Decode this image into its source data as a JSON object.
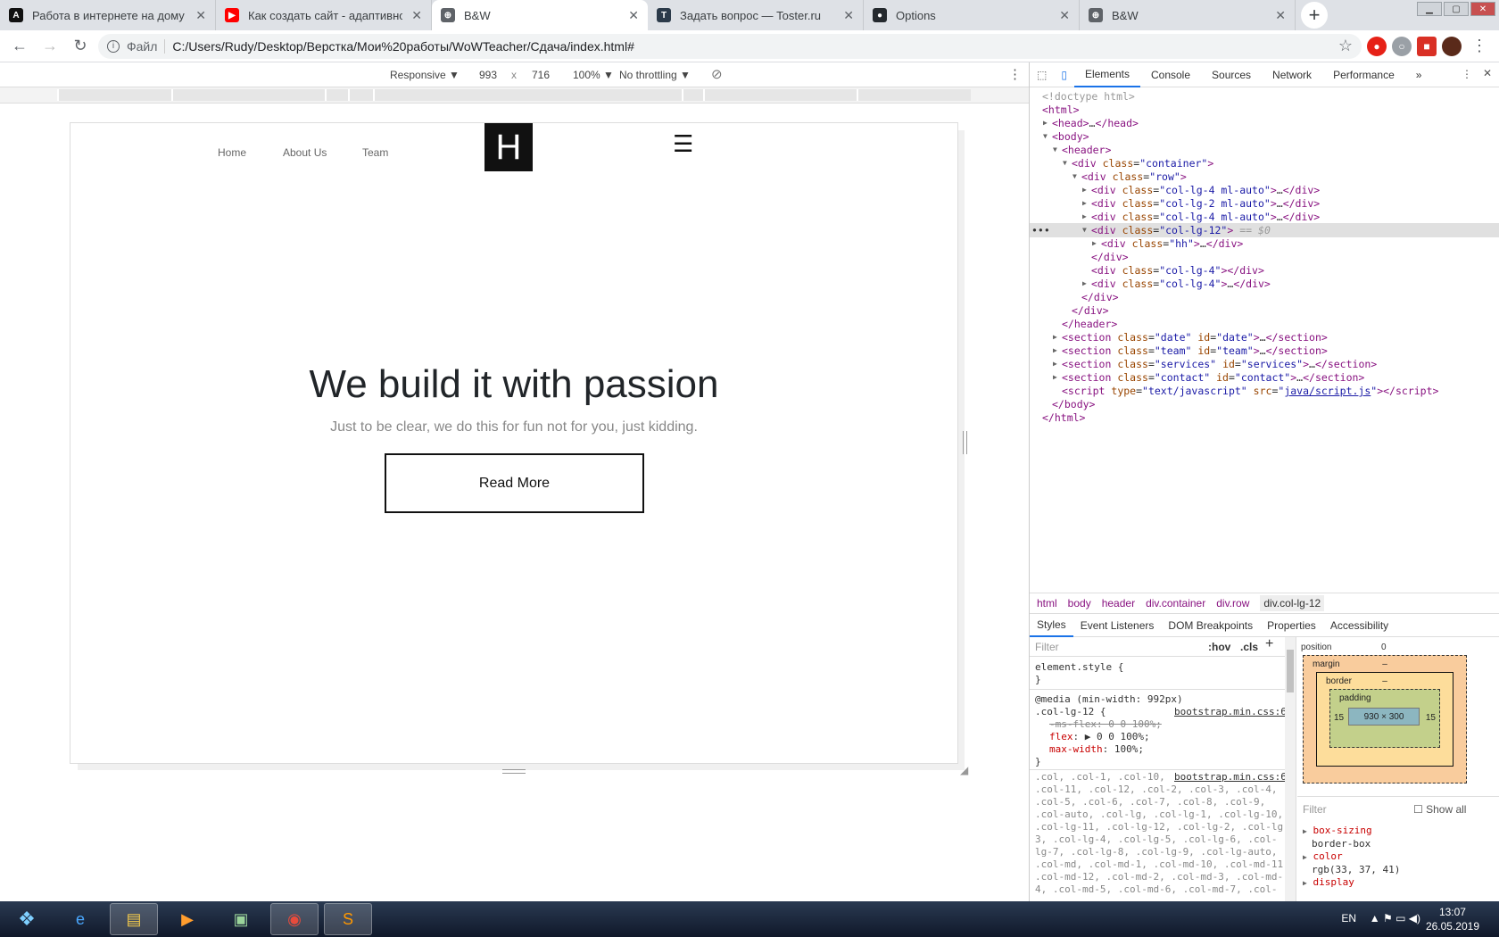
{
  "browser": {
    "tabs": [
      {
        "title": "Работа в интернете на дому он",
        "favicon": "A",
        "color": "#111111"
      },
      {
        "title": "Как создать сайт - адаптивное",
        "favicon": "▶",
        "color": "#ff0000"
      },
      {
        "title": "B&W",
        "favicon": "⊕",
        "color": "#5f6368",
        "active": true
      },
      {
        "title": "Задать вопрос — Toster.ru",
        "favicon": "T",
        "color": "#2b3a4a"
      },
      {
        "title": "Options",
        "favicon": "●",
        "color": "#24292e"
      },
      {
        "title": "B&W",
        "favicon": "⊕",
        "color": "#5f6368"
      }
    ],
    "address_label": "Файл",
    "url": "C:/Users/Rudy/Desktop/Верстка/Мои%20работы/WoWTeacher/Сдача/index.html#"
  },
  "device_toolbar": {
    "mode": "Responsive ▼",
    "width": "993",
    "times": "x",
    "height": "716",
    "zoom": "100% ▼",
    "throttling": "No throttling ▼"
  },
  "site": {
    "nav": [
      "Home",
      "About Us",
      "Team"
    ],
    "logo": "H",
    "menu_icon": "☰",
    "hero_title": "We build it with passion",
    "hero_subtitle": "Just to be clear, we do this for fun not for you, just kidding.",
    "button": "Read More"
  },
  "devtools": {
    "tabs": [
      "Elements",
      "Console",
      "Sources",
      "Network",
      "Performance",
      "»"
    ],
    "dom_lines": [
      {
        "d": 0,
        "html": "<span class='cm'>&lt;!doctype html&gt;</span>"
      },
      {
        "d": 0,
        "html": "<span class='tg'>&lt;html&gt;</span>"
      },
      {
        "d": 1,
        "arrow": "▶",
        "html": "<span class='tg'>&lt;head&gt;</span>…<span class='tg'>&lt;/head&gt;</span>"
      },
      {
        "d": 1,
        "arrow": "▼",
        "html": "<span class='tg'>&lt;body&gt;</span>"
      },
      {
        "d": 2,
        "arrow": "▼",
        "html": "<span class='tg'>&lt;header&gt;</span>"
      },
      {
        "d": 3,
        "arrow": "▼",
        "html": "<span class='tg'>&lt;div </span><span class='at'>class</span>=<span class='av'>\"container\"</span><span class='tg'>&gt;</span>"
      },
      {
        "d": 4,
        "arrow": "▼",
        "html": "<span class='tg'>&lt;div </span><span class='at'>class</span>=<span class='av'>\"row\"</span><span class='tg'>&gt;</span>"
      },
      {
        "d": 5,
        "arrow": "▶",
        "html": "<span class='tg'>&lt;div </span><span class='at'>class</span>=<span class='av'>\"col-lg-4 ml-auto\"</span><span class='tg'>&gt;</span>…<span class='tg'>&lt;/div&gt;</span>"
      },
      {
        "d": 5,
        "arrow": "▶",
        "html": "<span class='tg'>&lt;div </span><span class='at'>class</span>=<span class='av'>\"col-lg-2 ml-auto\"</span><span class='tg'>&gt;</span>…<span class='tg'>&lt;/div&gt;</span>"
      },
      {
        "d": 5,
        "arrow": "▶",
        "html": "<span class='tg'>&lt;div </span><span class='at'>class</span>=<span class='av'>\"col-lg-4 ml-auto\"</span><span class='tg'>&gt;</span>…<span class='tg'>&lt;/div&gt;</span>"
      },
      {
        "d": 5,
        "arrow": "▼",
        "sel": true,
        "html": "<span class='tg'>&lt;div </span><span class='at'>class</span>=<span class='av'>\"col-lg-12\"</span><span class='tg'>&gt;</span> <span class='cm'>== <i>$0</i></span>"
      },
      {
        "d": 6,
        "arrow": "▶",
        "html": "<span class='tg'>&lt;div </span><span class='at'>class</span>=<span class='av'>\"hh\"</span><span class='tg'>&gt;</span>…<span class='tg'>&lt;/div&gt;</span>"
      },
      {
        "d": 5,
        "html": "<span class='tg'>&lt;/div&gt;</span>"
      },
      {
        "d": 5,
        "html": "<span class='tg'>&lt;div </span><span class='at'>class</span>=<span class='av'>\"col-lg-4\"</span><span class='tg'>&gt;&lt;/div&gt;</span>"
      },
      {
        "d": 5,
        "arrow": "▶",
        "html": "<span class='tg'>&lt;div </span><span class='at'>class</span>=<span class='av'>\"col-lg-4\"</span><span class='tg'>&gt;</span>…<span class='tg'>&lt;/div&gt;</span>"
      },
      {
        "d": 4,
        "html": "<span class='tg'>&lt;/div&gt;</span>"
      },
      {
        "d": 3,
        "html": "<span class='tg'>&lt;/div&gt;</span>"
      },
      {
        "d": 2,
        "html": "<span class='tg'>&lt;/header&gt;</span>"
      },
      {
        "d": 2,
        "arrow": "▶",
        "html": "<span class='tg'>&lt;section </span><span class='at'>class</span>=<span class='av'>\"date\"</span> <span class='at'>id</span>=<span class='av'>\"date\"</span><span class='tg'>&gt;</span>…<span class='tg'>&lt;/section&gt;</span>"
      },
      {
        "d": 2,
        "arrow": "▶",
        "html": "<span class='tg'>&lt;section </span><span class='at'>class</span>=<span class='av'>\"team\"</span> <span class='at'>id</span>=<span class='av'>\"team\"</span><span class='tg'>&gt;</span>…<span class='tg'>&lt;/section&gt;</span>"
      },
      {
        "d": 2,
        "arrow": "▶",
        "html": "<span class='tg'>&lt;section </span><span class='at'>class</span>=<span class='av'>\"services\"</span> <span class='at'>id</span>=<span class='av'>\"services\"</span><span class='tg'>&gt;</span>…<span class='tg'>&lt;/section&gt;</span>"
      },
      {
        "d": 2,
        "arrow": "▶",
        "html": "<span class='tg'>&lt;section </span><span class='at'>class</span>=<span class='av'>\"contact\"</span> <span class='at'>id</span>=<span class='av'>\"contact\"</span><span class='tg'>&gt;</span>…<span class='tg'>&lt;/section&gt;</span>"
      },
      {
        "d": 2,
        "html": "<span class='tg'>&lt;script </span><span class='at'>type</span>=<span class='av'>\"text/javascript\"</span> <span class='at'>src</span>=<span class='av'>\"<u style='color:#1a1aa6'>java/script.js</u>\"</span><span class='tg'>&gt;&lt;/script&gt;</span>"
      },
      {
        "d": 1,
        "html": "<span class='tg'>&lt;/body&gt;</span>"
      },
      {
        "d": 0,
        "html": "<span class='tg'>&lt;/html&gt;</span>"
      }
    ],
    "breadcrumbs": [
      "html",
      "body",
      "header",
      "div.container",
      "div.row",
      "div.col-lg-12"
    ],
    "subtabs": [
      "Styles",
      "Event Listeners",
      "DOM Breakpoints",
      "Properties",
      "Accessibility"
    ],
    "filter_placeholder": "Filter",
    "hov": ":hov",
    "cls": ".cls",
    "styles": {
      "element_style": "element.style {",
      "close": "}",
      "media": "@media (min-width: 992px)",
      "rule1_selector": ".col-lg-12 {",
      "rule1_source": "bootstrap.min.css:6",
      "prop1": "-ms-flex: 0 0 100%;",
      "prop2_name": "flex",
      "prop2_value": "▶ 0 0 100%;",
      "prop3_name": "max-width",
      "prop3_value": "100%;",
      "rule2_source": "bootstrap.min.css:6",
      "rule2_lines": [
        ".col, .col-1, .col-10,",
        ".col-11, .col-12, .col-2, .col-3, .col-4,",
        ".col-5, .col-6, .col-7, .col-8, .col-9,",
        ".col-auto, .col-lg, .col-lg-1, .col-lg-10,",
        ".col-lg-11, .col-lg-12, .col-lg-2, .col-lg-",
        "3, .col-lg-4, .col-lg-5, .col-lg-6, .col-",
        "lg-7, .col-lg-8, .col-lg-9, .col-lg-auto,",
        ".col-md, .col-md-1, .col-md-10, .col-md-11,",
        ".col-md-12, .col-md-2, .col-md-3, .col-md-",
        "4, .col-md-5, .col-md-6, .col-md-7, .col-"
      ]
    },
    "boxmodel": {
      "position_label": "position",
      "position_value": "0",
      "margin_label": "margin",
      "border_label": "border",
      "padding_label": "padding",
      "dash": "–",
      "pad_left": "15",
      "pad_right": "15",
      "content": "930 × 300",
      "filter": "Filter",
      "show_all": "Show all",
      "computed": [
        {
          "name": "box-sizing",
          "value": "border-box"
        },
        {
          "name": "color",
          "value": "rgb(33, 37, 41)"
        },
        {
          "name": "display",
          "value": ""
        }
      ]
    }
  },
  "taskbar": {
    "lang": "EN",
    "time": "13:07",
    "date": "26.05.2019"
  }
}
